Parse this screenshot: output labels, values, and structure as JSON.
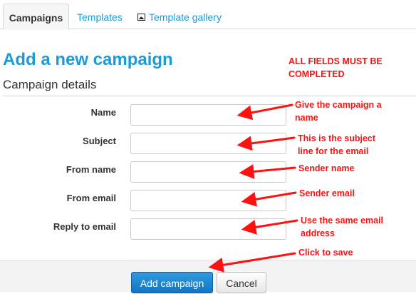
{
  "tabs": [
    {
      "label": "Campaigns",
      "active": true
    },
    {
      "label": "Templates",
      "active": false
    },
    {
      "label": "Template gallery",
      "active": false,
      "icon": "picture-icon"
    }
  ],
  "page": {
    "title": "Add a new campaign",
    "section_title": "Campaign details"
  },
  "annotations": {
    "warning": [
      "ALL FIELDS MUST BE",
      "COMPLETED"
    ],
    "name": [
      "Give the campaign a",
      "name"
    ],
    "subject": [
      "This is the subject",
      "line for the email"
    ],
    "from_name": [
      "Sender name"
    ],
    "from_email": [
      "Sender email"
    ],
    "reply_to": [
      "Use the same email",
      "address"
    ],
    "save": [
      "Click to save"
    ],
    "color": "#ff1111"
  },
  "form": {
    "fields": [
      {
        "label": "Name",
        "value": ""
      },
      {
        "label": "Subject",
        "value": ""
      },
      {
        "label": "From name",
        "value": ""
      },
      {
        "label": "From email",
        "value": ""
      },
      {
        "label": "Reply to email",
        "value": ""
      }
    ],
    "submit_label": "Add campaign",
    "cancel_label": "Cancel"
  },
  "colors": {
    "accent": "#1a9bd7",
    "primary_button": "#1474c4",
    "annotation": "#ff1111"
  }
}
